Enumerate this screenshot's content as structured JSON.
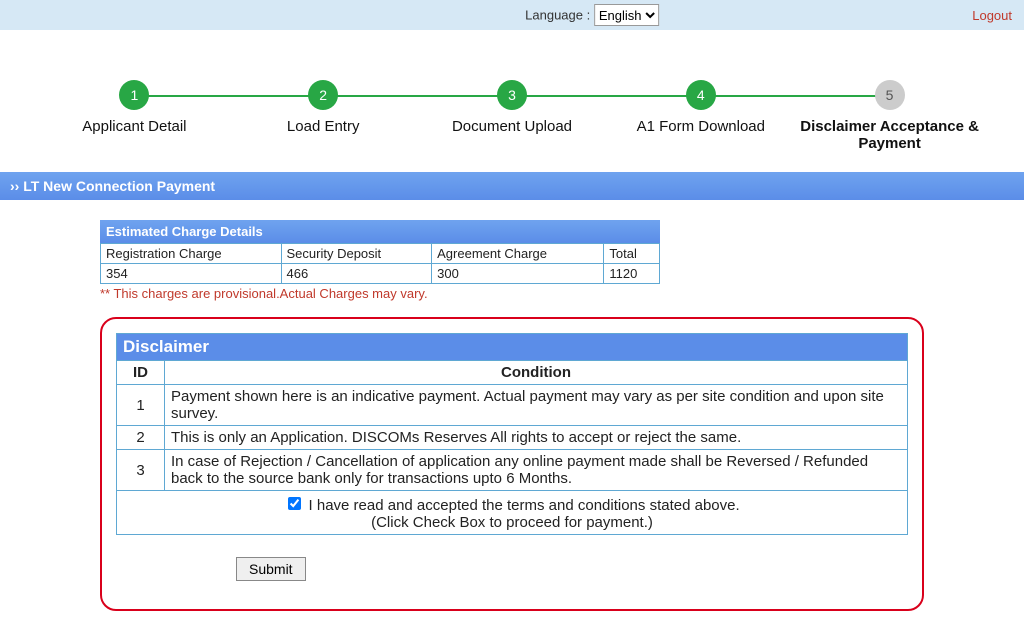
{
  "topbar": {
    "language_label": "Language :",
    "language_value": "English",
    "logout": "Logout"
  },
  "steps": [
    {
      "num": "1",
      "label": "Applicant Detail",
      "active": false
    },
    {
      "num": "2",
      "label": "Load Entry",
      "active": false
    },
    {
      "num": "3",
      "label": "Document Upload",
      "active": false
    },
    {
      "num": "4",
      "label": "A1 Form Download",
      "active": false
    },
    {
      "num": "5",
      "label": "Disclaimer Acceptance & Payment",
      "active": true
    }
  ],
  "section_title": "›› LT New Connection Payment",
  "estimated": {
    "header": "Estimated Charge Details",
    "cols": [
      "Registration Charge",
      "Security Deposit",
      "Agreement Charge",
      "Total"
    ],
    "vals": [
      "354",
      "466",
      "300",
      "1120"
    ],
    "note": "** This charges are provisional.Actual Charges may vary."
  },
  "disclaimer": {
    "header": "Disclaimer",
    "th_id": "ID",
    "th_cond": "Condition",
    "rows": [
      {
        "id": "1",
        "text": "Payment shown here is an indicative payment. Actual payment may vary as per site condition and upon site survey."
      },
      {
        "id": "2",
        "text": "This is only an Application. DISCOMs Reserves All rights to accept or reject the same."
      },
      {
        "id": "3",
        "text": "In case of Rejection / Cancellation of application any online payment made shall be Reversed / Refunded back to the source bank only for transactions upto 6 Months."
      }
    ],
    "consent": "I have read and accepted the terms and conditions stated above.",
    "consent_hint": "(Click Check Box to proceed for payment.)",
    "consent_checked": true
  },
  "submit_label": "Submit"
}
